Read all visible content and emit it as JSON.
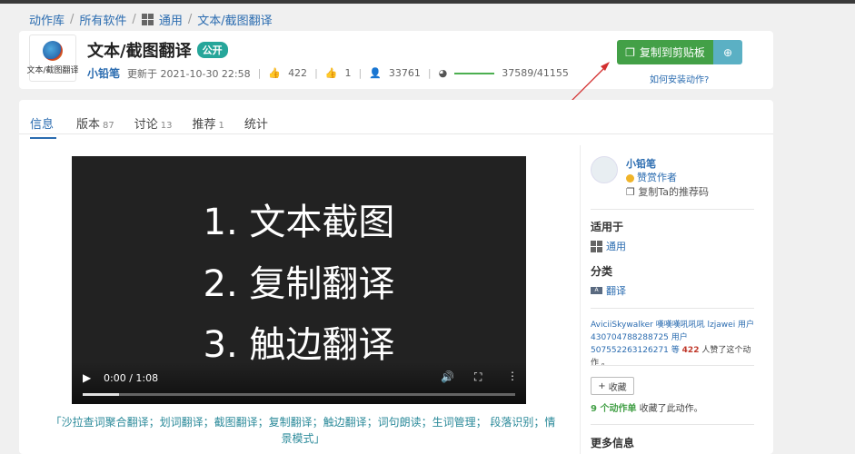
{
  "breadcrumb": [
    "动作库",
    "所有软件",
    "通用",
    "文本/截图翻译"
  ],
  "header": {
    "app_icon_label": "文本/截图翻译",
    "title": "文本/截图翻译",
    "badge": "公开",
    "author": "小铅笔",
    "updated": "更新于 2021-10-30 22:58",
    "likes": "422",
    "thumbs": "1",
    "users": "33761",
    "progress_text": "37589/41155",
    "progress_fraction": 0.913,
    "copy_button": "复制到剪贴板",
    "install_link": "如何安装动作?"
  },
  "tabs": [
    {
      "label": "信息",
      "count": ""
    },
    {
      "label": "版本",
      "count": "87"
    },
    {
      "label": "讨论",
      "count": "13"
    },
    {
      "label": "推荐",
      "count": "1"
    },
    {
      "label": "统计",
      "count": ""
    }
  ],
  "video": {
    "line1": "1. 文本截图",
    "line2": "2. 复制翻译",
    "line3": "3. 触边翻译",
    "time": "0:00 / 1:08"
  },
  "description": "「沙拉查词聚合翻译；划词翻译；截图翻译；复制翻译；触边翻译；词句朗读；生词管理； 段落识别；情景模式」",
  "sidebar": {
    "author": "小铅笔",
    "praise": "赞赏作者",
    "referral": "复制Ta的推荐码",
    "applies_title": "适用于",
    "applies_value": "通用",
    "category_title": "分类",
    "category_value": "翻译",
    "likers_text": "AviciiSkywalker 嘆嘆嘆吼吼吼 lzjawei 用户430704788288725 用户507552263126271",
    "likers_and": "等",
    "likers_count": "422",
    "likers_suffix": "人赞了这个动作 。",
    "fav_button": "收藏",
    "fav_count": "9 个动作单",
    "fav_suffix": "收藏了此动作。",
    "more_info": "更多信息"
  },
  "colors": {
    "accent": "#2b6cb0",
    "primary_button": "#43a047",
    "badge": "#26a69a",
    "arrow": "#d32f2f"
  }
}
